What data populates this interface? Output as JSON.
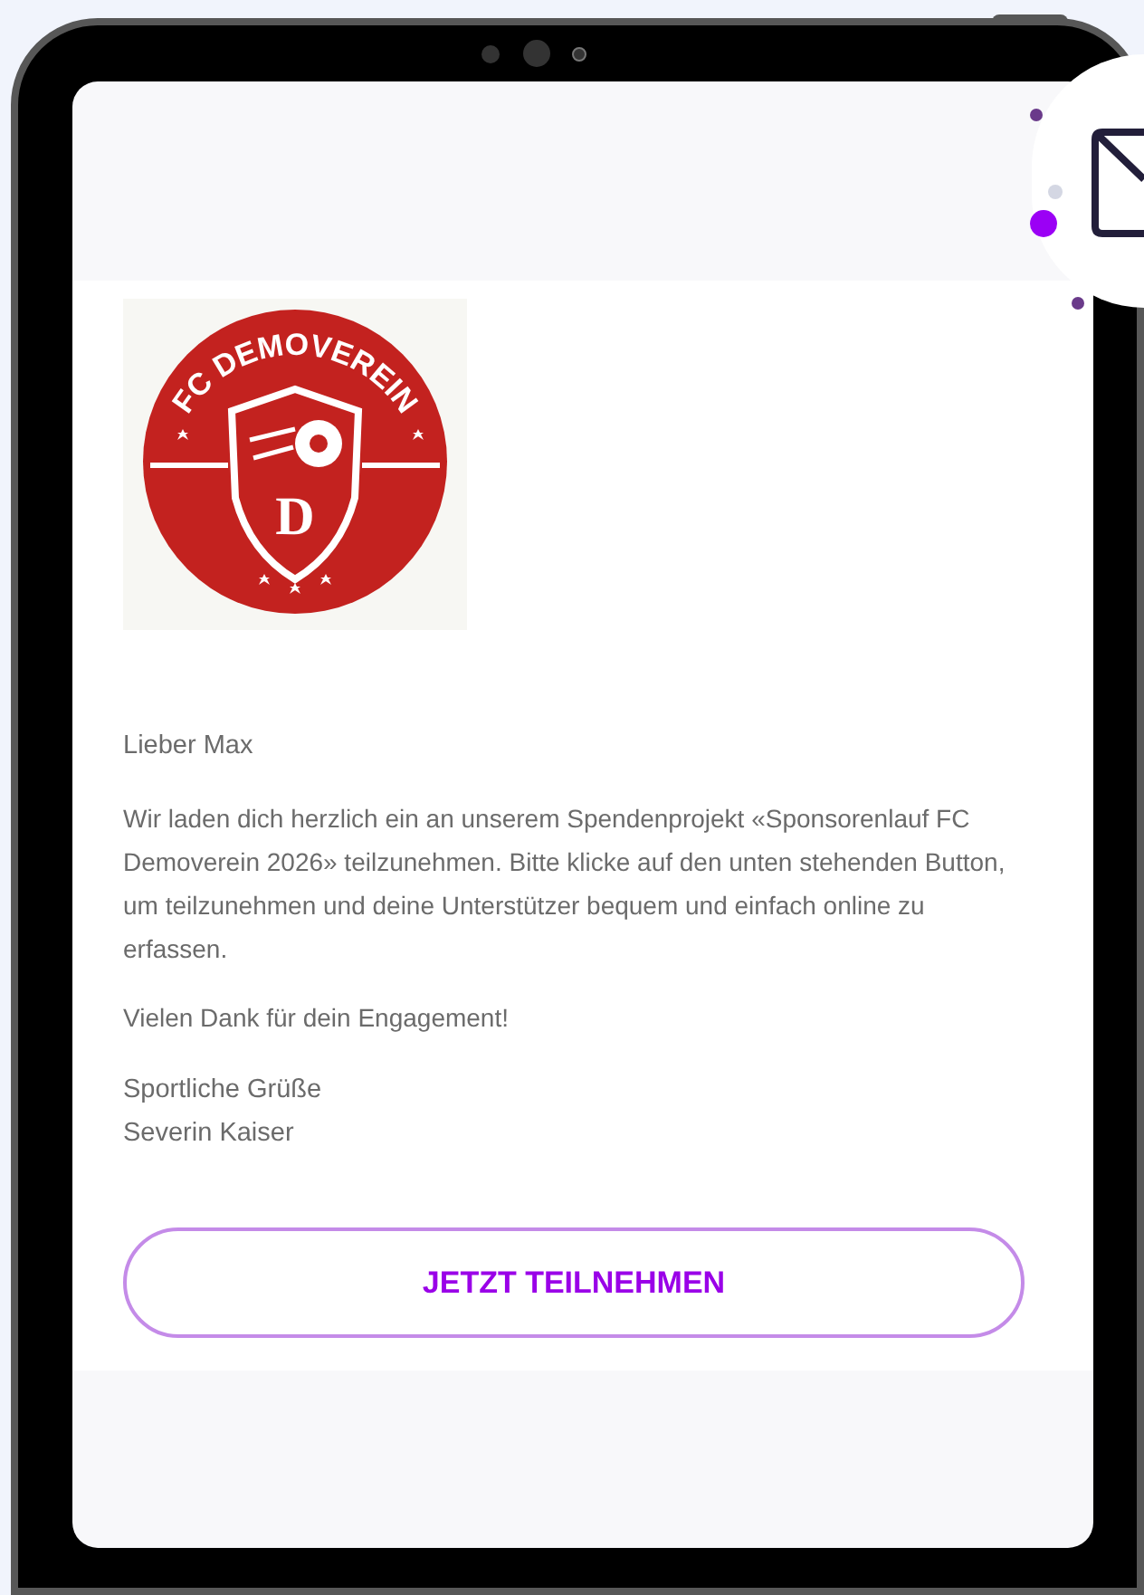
{
  "logo": {
    "name": "FC DEMOVEREIN",
    "letter": "D"
  },
  "greeting": "Lieber Max",
  "paragraphs": [
    "Wir laden dich herzlich ein an unserem Spendenprojekt «Sponsorenlauf FC Demoverein 2026» teilzunehmen. Bitte klicke auf den unten stehenden Button, um teilzunehmen und deine Unterstützer bequem und einfach online zu erfassen.",
    "Vielen Dank für dein Engagement!"
  ],
  "signature": [
    "Sportliche Grüße",
    "Severin Kaiser"
  ],
  "button": "JETZT TEILNEHMEN"
}
